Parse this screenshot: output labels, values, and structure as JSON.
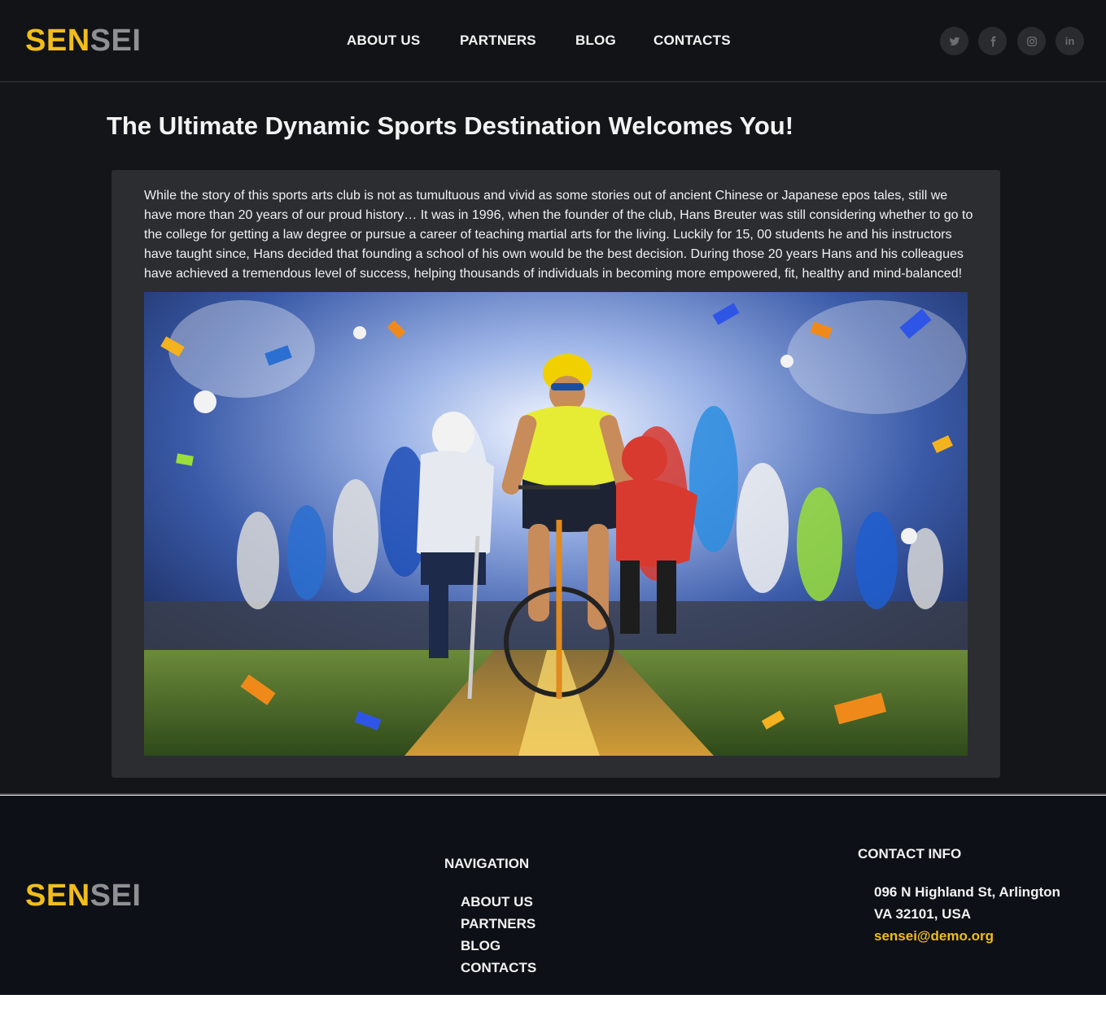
{
  "brand": {
    "logo_part1": "SEN",
    "logo_part2": "SEI"
  },
  "nav": {
    "items": [
      {
        "label": "ABOUT US"
      },
      {
        "label": "PARTNERS"
      },
      {
        "label": "BLOG"
      },
      {
        "label": "CONTACTS"
      }
    ]
  },
  "social": [
    {
      "icon": "twitter-icon"
    },
    {
      "icon": "facebook-icon"
    },
    {
      "icon": "instagram-icon"
    },
    {
      "icon": "linkedin-icon",
      "text": "in"
    }
  ],
  "main": {
    "title": "The Ultimate Dynamic Sports Destination Welcomes You!",
    "body": "While the story of this sports arts club is not as tumultuous and vivid as some stories out of ancient Chinese or Japanese epos tales, still we have more than 20 years of our proud history… It was in 1996, when the founder of the club, Hans Breuter was still considering whether to go to the college for getting a law degree or pursue a career of teaching martial arts for the living. Luckily for 15, 00 students he and his instructors have taught since, Hans decided that founding a school of his own would be the best decision. During those 20 years Hans and his colleagues have achieved a tremendous level of success, helping thousands of individuals in becoming more empowered, fit, healthy and mind-balanced!"
  },
  "footer": {
    "navigation_heading": "NAVIGATION",
    "links": [
      {
        "label": "ABOUT US"
      },
      {
        "label": "PARTNERS"
      },
      {
        "label": "BLOG"
      },
      {
        "label": "CONTACTS"
      }
    ],
    "contact_heading": "CONTACT INFO",
    "address_line1": "096 N Highland St, Arlington",
    "address_line2": "VA 32101, USA",
    "email": "sensei@demo.org"
  },
  "colors": {
    "accent": "#f0bd1c",
    "logo_gray": "#8f9094",
    "background": "#141518",
    "card": "#2c2d31",
    "footer": "#0d1016"
  }
}
